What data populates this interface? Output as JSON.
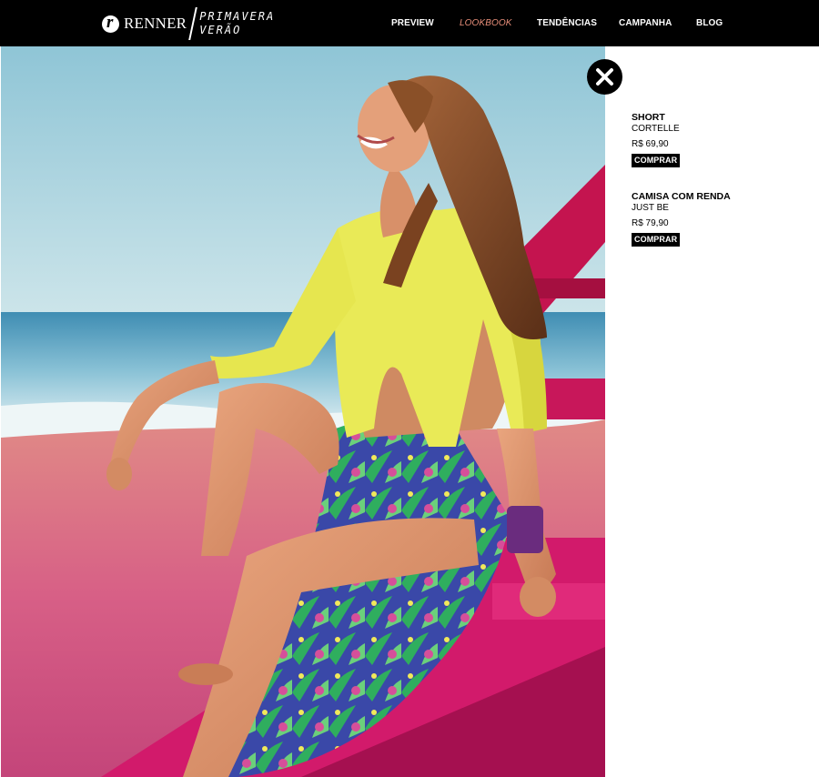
{
  "header": {
    "brand_name": "RENNER",
    "tagline_line1": "PRIMAVERA",
    "tagline_line2": "VERÃO",
    "nav": [
      {
        "label": "PREVIEW",
        "active": false
      },
      {
        "label": "LOOKBOOK",
        "active": true
      },
      {
        "label": "TENDÊNCIAS",
        "active": false
      },
      {
        "label": "CAMPANHA",
        "active": false
      },
      {
        "label": "BLOG",
        "active": false
      }
    ],
    "active_color": "#e98f7a"
  },
  "products": [
    {
      "name": "SHORT",
      "brand": "CORTELLE",
      "price": "R$ 69,90",
      "button": "COMPRAR"
    },
    {
      "name": "CAMISA COM RENDA",
      "brand": "JUST BE",
      "price": "R$ 79,90",
      "button": "COMPRAR"
    }
  ],
  "icons": {
    "close": "close-icon",
    "logo": "renner-logo-icon"
  },
  "colors": {
    "background": "#ffffff",
    "header_bg": "#000000",
    "button_bg": "#000000"
  }
}
